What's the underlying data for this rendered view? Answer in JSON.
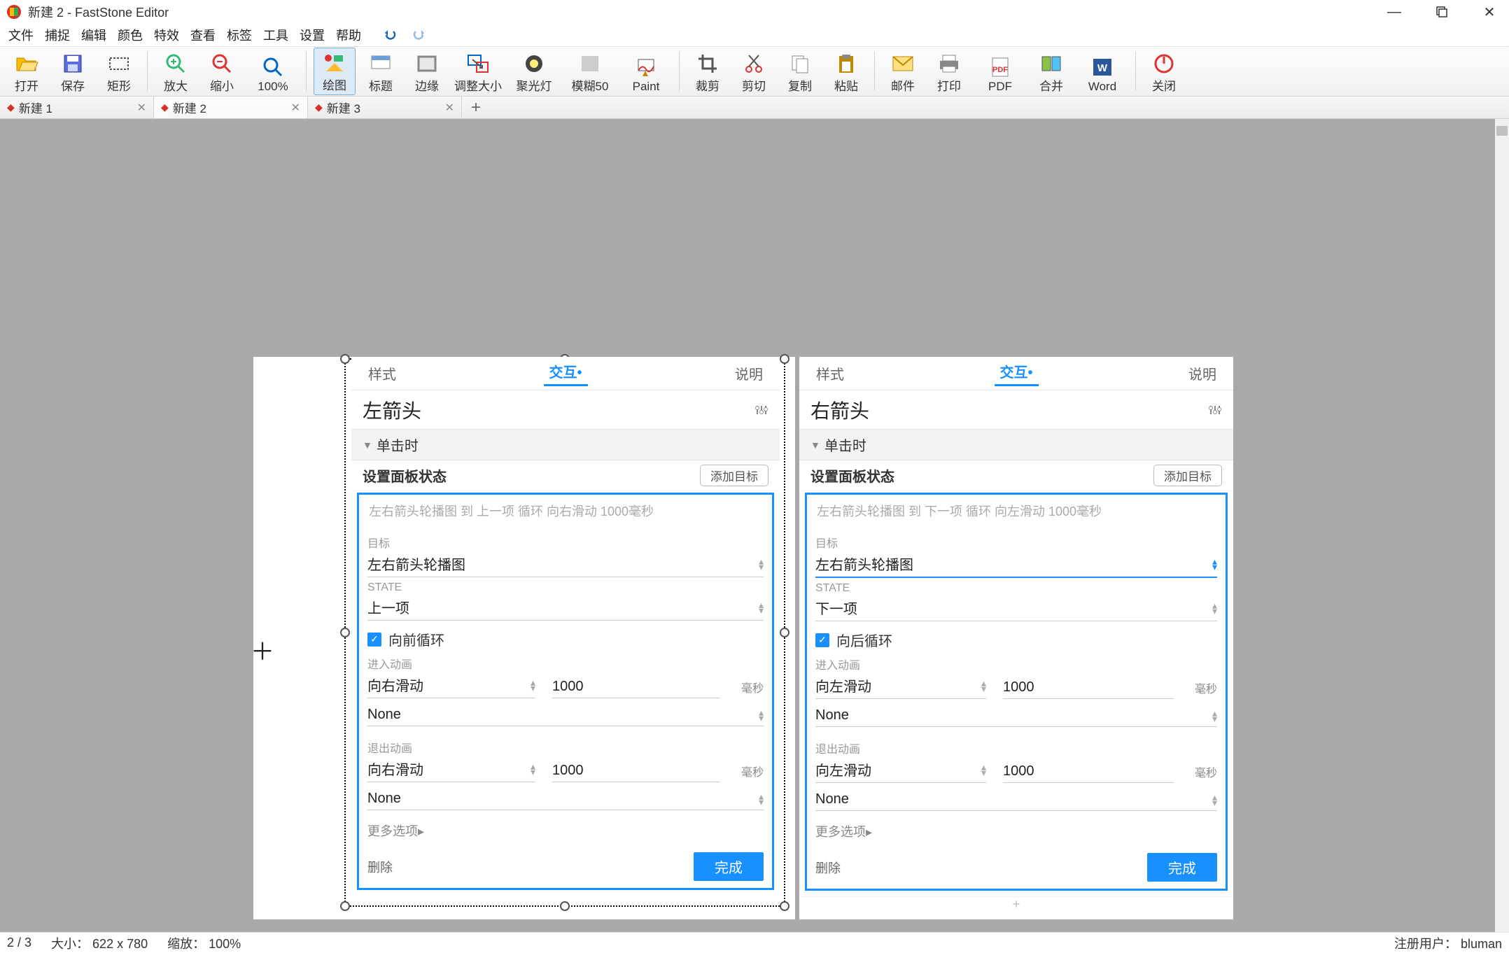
{
  "window": {
    "title": "新建 2 - FastStone Editor"
  },
  "menu": [
    "文件",
    "捕捉",
    "编辑",
    "颜色",
    "特效",
    "查看",
    "标签",
    "工具",
    "设置",
    "帮助"
  ],
  "toolbar": [
    {
      "label": "打开",
      "icon": "open"
    },
    {
      "label": "保存",
      "icon": "save"
    },
    {
      "label": "矩形",
      "icon": "rect"
    },
    {
      "label": "放大",
      "icon": "zoomin"
    },
    {
      "label": "缩小",
      "icon": "zoomout"
    },
    {
      "label": "100%",
      "icon": "zoom100"
    },
    {
      "label": "绘图",
      "icon": "draw",
      "active": true
    },
    {
      "label": "标题",
      "icon": "caption"
    },
    {
      "label": "边缘",
      "icon": "edge"
    },
    {
      "label": "调整大小",
      "icon": "resize"
    },
    {
      "label": "聚光灯",
      "icon": "spotlight"
    },
    {
      "label": "模糊50",
      "icon": "blur"
    },
    {
      "label": "Paint",
      "icon": "paint"
    },
    {
      "label": "裁剪",
      "icon": "crop"
    },
    {
      "label": "剪切",
      "icon": "cut"
    },
    {
      "label": "复制",
      "icon": "copy"
    },
    {
      "label": "粘贴",
      "icon": "paste"
    },
    {
      "label": "邮件",
      "icon": "mail"
    },
    {
      "label": "打印",
      "icon": "print"
    },
    {
      "label": "PDF",
      "icon": "pdf"
    },
    {
      "label": "合并",
      "icon": "merge"
    },
    {
      "label": "Word",
      "icon": "word"
    },
    {
      "label": "关闭",
      "icon": "close"
    }
  ],
  "tabs": [
    {
      "label": "新建 1",
      "active": false
    },
    {
      "label": "新建 2",
      "active": true
    },
    {
      "label": "新建 3",
      "active": false
    }
  ],
  "status": {
    "index": "2 / 3",
    "size_label": "大小：",
    "size": "622 x 780",
    "zoom_label": "缩放：",
    "zoom": "100%",
    "user_label": "注册用户：",
    "user": "bluman"
  },
  "panel_tabs": {
    "style": "样式",
    "interact": "交互",
    "desc": "说明"
  },
  "left_panel": {
    "title": "左箭头",
    "on_click": "单击时",
    "set_state": "设置面板状态",
    "add_target": "添加目标",
    "desc": "左右箭头轮播图 到 上一项 循环 向右滑动 1000毫秒",
    "target_label": "目标",
    "target": "左右箭头轮播图",
    "state_label": "STATE",
    "state": "上一项",
    "loop": "向前循环",
    "enter_label": "进入动画",
    "enter": "向右滑动",
    "enter_ms": "1000",
    "ms_unit": "毫秒",
    "none": "None",
    "exit_label": "退出动画",
    "exit": "向右滑动",
    "exit_ms": "1000",
    "more": "更多选项▸",
    "delete": "删除",
    "done": "完成"
  },
  "right_panel": {
    "title": "右箭头",
    "on_click": "单击时",
    "set_state": "设置面板状态",
    "add_target": "添加目标",
    "desc": "左右箭头轮播图 到 下一项 循环 向左滑动 1000毫秒",
    "target_label": "目标",
    "target": "左右箭头轮播图",
    "state_label": "STATE",
    "state": "下一项",
    "loop": "向后循环",
    "enter_label": "进入动画",
    "enter": "向左滑动",
    "enter_ms": "1000",
    "ms_unit": "毫秒",
    "none": "None",
    "exit_label": "退出动画",
    "exit": "向左滑动",
    "exit_ms": "1000",
    "more": "更多选项▸",
    "delete": "删除",
    "done": "完成"
  }
}
